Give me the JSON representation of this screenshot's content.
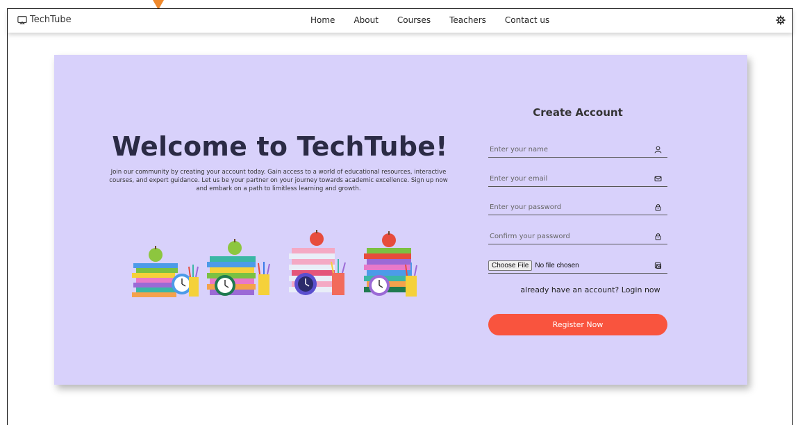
{
  "navbar": {
    "brand": "TechTube",
    "links": [
      "Home",
      "About",
      "Courses",
      "Teachers",
      "Contact us"
    ]
  },
  "hero": {
    "title": "Welcome to TechTube!",
    "intro": "Join our community by creating your account today. Gain access to a world of educational resources, interactive courses, and expert guidance. Let us be your partner on your journey towards academic excellence. Sign up now and embark on a path to limitless learning and growth."
  },
  "form": {
    "title": "Create Account",
    "name_placeholder": "Enter your name",
    "email_placeholder": "Enter your email",
    "password_placeholder": "Enter your password",
    "confirm_placeholder": "Confirm your password",
    "file_button": "Choose File",
    "file_status": "No file chosen",
    "login_text": "already have an account? Login now",
    "register_label": "Register Now"
  },
  "colors": {
    "card_bg": "#d8d1fb",
    "accent": "#f9543e",
    "cursor_marker": "#f0892c"
  },
  "icons": [
    "monitor-icon",
    "gear-icon",
    "user-icon",
    "mail-icon",
    "lock-icon",
    "lock-icon",
    "image-upload-icon"
  ]
}
